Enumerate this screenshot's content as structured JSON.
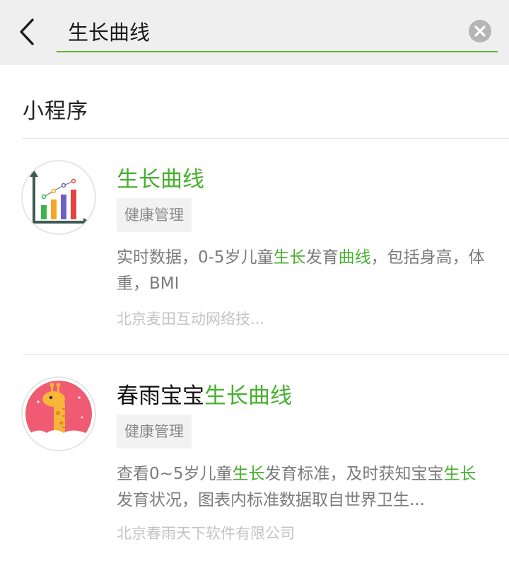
{
  "search": {
    "query": "生长曲线"
  },
  "section": {
    "title": "小程序"
  },
  "results": [
    {
      "title_parts": [
        "",
        "生长曲线",
        ""
      ],
      "tag": "健康管理",
      "desc_parts": [
        "实时数据，0-5岁儿童",
        "生长",
        "发育",
        "曲线",
        "，包括身高，体重，BMI"
      ],
      "company": "北京麦田互动网络技..."
    },
    {
      "title_parts": [
        "春雨宝宝",
        "生长曲线",
        ""
      ],
      "tag": "健康管理",
      "desc_parts": [
        "查看0~5岁儿童",
        "生长",
        "发育标准，及时获知宝宝",
        "生长",
        "发育状况，图表内标准数据取自世界卫生..."
      ],
      "company": "北京春雨天下软件有限公司"
    }
  ],
  "colors": {
    "highlight": "#46b02d",
    "search_underline": "#62b22f",
    "topbar_bg": "#efefef"
  }
}
